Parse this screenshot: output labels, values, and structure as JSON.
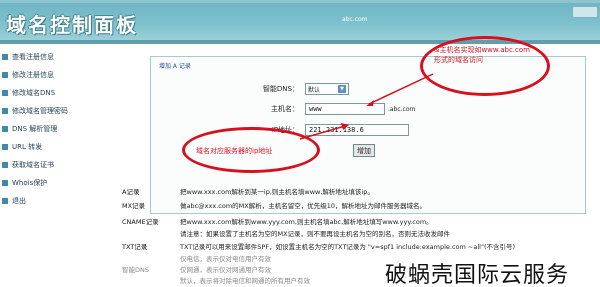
{
  "header": {
    "title": "域名控制面板",
    "site": "abc.com"
  },
  "sidebar": {
    "items": [
      {
        "label": "查看注册信息"
      },
      {
        "label": "修改注册信息"
      },
      {
        "label": "修改域名DNS"
      },
      {
        "label": "修改域名管理密码"
      },
      {
        "label": "DNS 解析管理"
      },
      {
        "label": "URL 转发"
      },
      {
        "label": "获取域名证书"
      },
      {
        "label": "Whois保护"
      },
      {
        "label": "退出"
      }
    ]
  },
  "panel": {
    "title": "增加 A 记录",
    "dns_label": "智能DNS：",
    "dns_value": "默认",
    "host_label": "主机名：",
    "host_value": "www",
    "host_suffix": ".abc.com",
    "ip_label": "IP地址：",
    "ip_value": "221.231.138.6",
    "add_button": "增加"
  },
  "annotations": {
    "top_right": [
      "&主机名实现如www.abc.com",
      "形式的域名访问"
    ],
    "left": "域名对应服务器的ip地址"
  },
  "rows": [
    {
      "k": "A记录",
      "v": "把www.xxx.com解析到某一ip,则主机名填www,解析地址填该ip。"
    },
    {
      "k": "MX记录",
      "v": "做abc@xxx.com的MX解析，主机名留空，优先级10，解析地址为邮件服务器域名。"
    },
    {
      "k": "CNAME记录",
      "v": "把www.xxx.com解析到www.yyy.com,则主机名填abc,解析地址填写www.yyy.com。"
    },
    {
      "k": "",
      "v": "请注意：如果设置了主机名为空的MX记录，则不要再设主机名为空的别名，否则无法收发邮件"
    },
    {
      "k": "TXT记录",
      "v": "TXT记录可以用来设置邮件SPF，如设置主机名为空的TXT记录为 \"v=spf1 include:example.com ~all\"(不含引号)"
    },
    {
      "k": "",
      "v": "仅电信，表示仅对电信用户有效"
    },
    {
      "k": "智能DNS",
      "v": "仅网通，表示仅对网通用户有效"
    },
    {
      "k": "",
      "v": "默认，表示将对除电信和网通的所有用户有效"
    }
  ],
  "watermark": "破蜗壳国际云服务"
}
